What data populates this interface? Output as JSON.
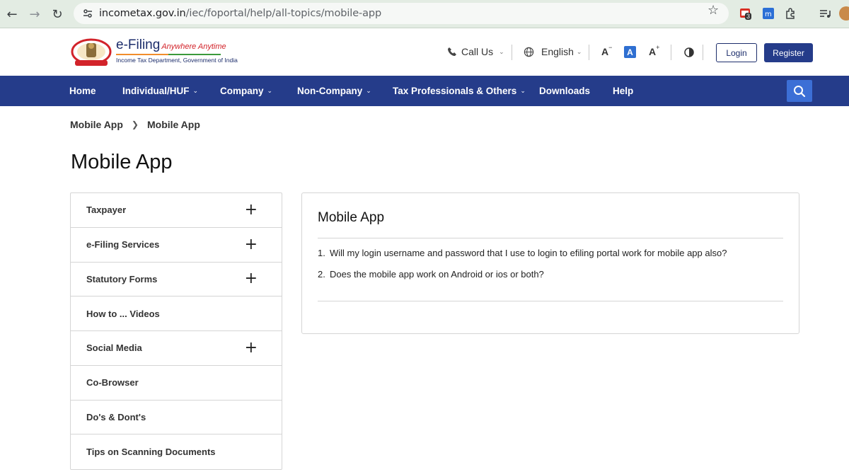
{
  "browser": {
    "url_host": "incometax.gov.in",
    "url_path": "/iec/foportal/help/all-topics/mobile-app",
    "extension_badge": "3",
    "icons": [
      "back-icon",
      "forward-icon",
      "reload-icon",
      "site-info-icon",
      "star-icon",
      "extension-icon",
      "puzzle-icon",
      "media-icon",
      "avatar"
    ]
  },
  "header": {
    "logo_title": "e-Filing",
    "logo_tagline": "Anywhere Anytime",
    "logo_subtitle": "Income Tax Department, Government of India",
    "call_us": "Call Us",
    "language": "English",
    "login": "Login",
    "register": "Register"
  },
  "nav": {
    "items": [
      {
        "label": "Home"
      },
      {
        "label": "Individual/HUF"
      },
      {
        "label": "Company"
      },
      {
        "label": "Non-Company"
      },
      {
        "label": "Tax Professionals & Others"
      },
      {
        "label": "Downloads"
      },
      {
        "label": "Help"
      }
    ]
  },
  "breadcrumb": [
    "Mobile App",
    "Mobile App"
  ],
  "page_title": "Mobile App",
  "sidebar": {
    "items": [
      {
        "label": "Taxpayer",
        "expandable": true
      },
      {
        "label": "e-Filing Services",
        "expandable": true
      },
      {
        "label": "Statutory Forms",
        "expandable": true
      },
      {
        "label": "How to ... Videos",
        "expandable": false
      },
      {
        "label": "Social Media",
        "expandable": true
      },
      {
        "label": "Co-Browser",
        "expandable": false
      },
      {
        "label": "Do's & Dont's",
        "expandable": false
      },
      {
        "label": "Tips on Scanning Documents",
        "expandable": false
      }
    ],
    "expand_glyph": "+"
  },
  "content": {
    "title": "Mobile App",
    "faqs": [
      {
        "num": "1.",
        "text": "Will my login username and password that I use to login to efiling portal work for mobile app also?"
      },
      {
        "num": "2.",
        "text": "Does the mobile app work on Android or ios or both?"
      }
    ]
  },
  "colors": {
    "nav_bg": "#253c8a",
    "search_bg": "#3c6fd6",
    "chrome_bg": "#e3ece3"
  }
}
